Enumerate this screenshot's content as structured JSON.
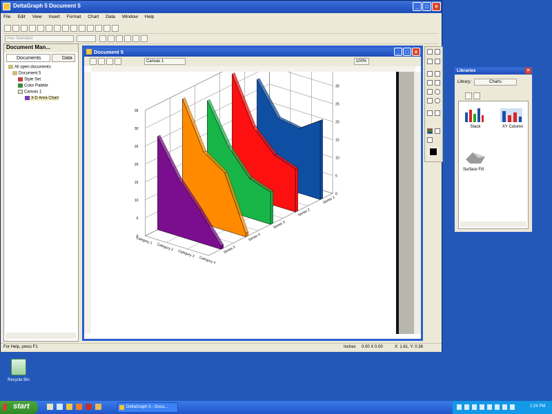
{
  "app": {
    "title": "DeltaGraph 5 Document 5",
    "menu": [
      "File",
      "Edit",
      "View",
      "Insert",
      "Format",
      "Chart",
      "Data",
      "Window",
      "Help"
    ],
    "style_combo": "Axis Standard",
    "status_left": "For Help, press F1",
    "status_units": "Inches",
    "status_xy": "0.00 X 0.00",
    "status_cursor": "X: 1.61, Y: 0.36"
  },
  "doc_manager": {
    "title": "Document Man...",
    "tabs": [
      "Documents",
      "Data"
    ],
    "tree": [
      {
        "label": "All open documents",
        "level": 0
      },
      {
        "label": "Document 5",
        "level": 1
      },
      {
        "label": "Style Set",
        "level": 2
      },
      {
        "label": "Color Palette",
        "level": 2
      },
      {
        "label": "Canvas 1",
        "level": 2
      },
      {
        "label": "3-D Area Chart",
        "level": 3
      }
    ]
  },
  "document": {
    "title": "Document 5",
    "canvas_select": "Canvas 1",
    "zoom": "100%"
  },
  "libraries": {
    "title": "Libraries",
    "library_label": "Library:",
    "library_value": "Charts",
    "items": [
      "Stack",
      "XY Column",
      "Surface Fill"
    ]
  },
  "desktop": {
    "recycle_label": "Recycle Bin",
    "start_label": "start",
    "task_item": "DeltaGraph 5 - Docu...",
    "clock": "2:24 PM"
  },
  "chart_data": {
    "type": "area",
    "categories": [
      "Category 1",
      "Category 2",
      "Category 3",
      "Category 4"
    ],
    "series": [
      {
        "name": "Series 1",
        "color": "#7b0e8f",
        "values": [
          26,
          16,
          9,
          1
        ]
      },
      {
        "name": "Series 2",
        "color": "#ff8a00",
        "values": [
          33,
          20,
          16,
          1
        ]
      },
      {
        "name": "Series 3",
        "color": "#18b548",
        "values": [
          29,
          18,
          11,
          9
        ]
      },
      {
        "name": "Series 4",
        "color": "#ff1010",
        "values": [
          33,
          20,
          14,
          12
        ]
      },
      {
        "name": "Series 5",
        "color": "#0f4fa3",
        "values": [
          28,
          19,
          18,
          22
        ]
      }
    ],
    "z_labels": [
      "Series 5",
      "Series 4",
      "Series 3",
      "Series 2",
      "Series 1"
    ],
    "y_ticks": [
      "35",
      "30",
      "25",
      "20",
      "15",
      "10",
      "5",
      "0"
    ],
    "ylim": [
      0,
      35
    ],
    "grid": true
  }
}
